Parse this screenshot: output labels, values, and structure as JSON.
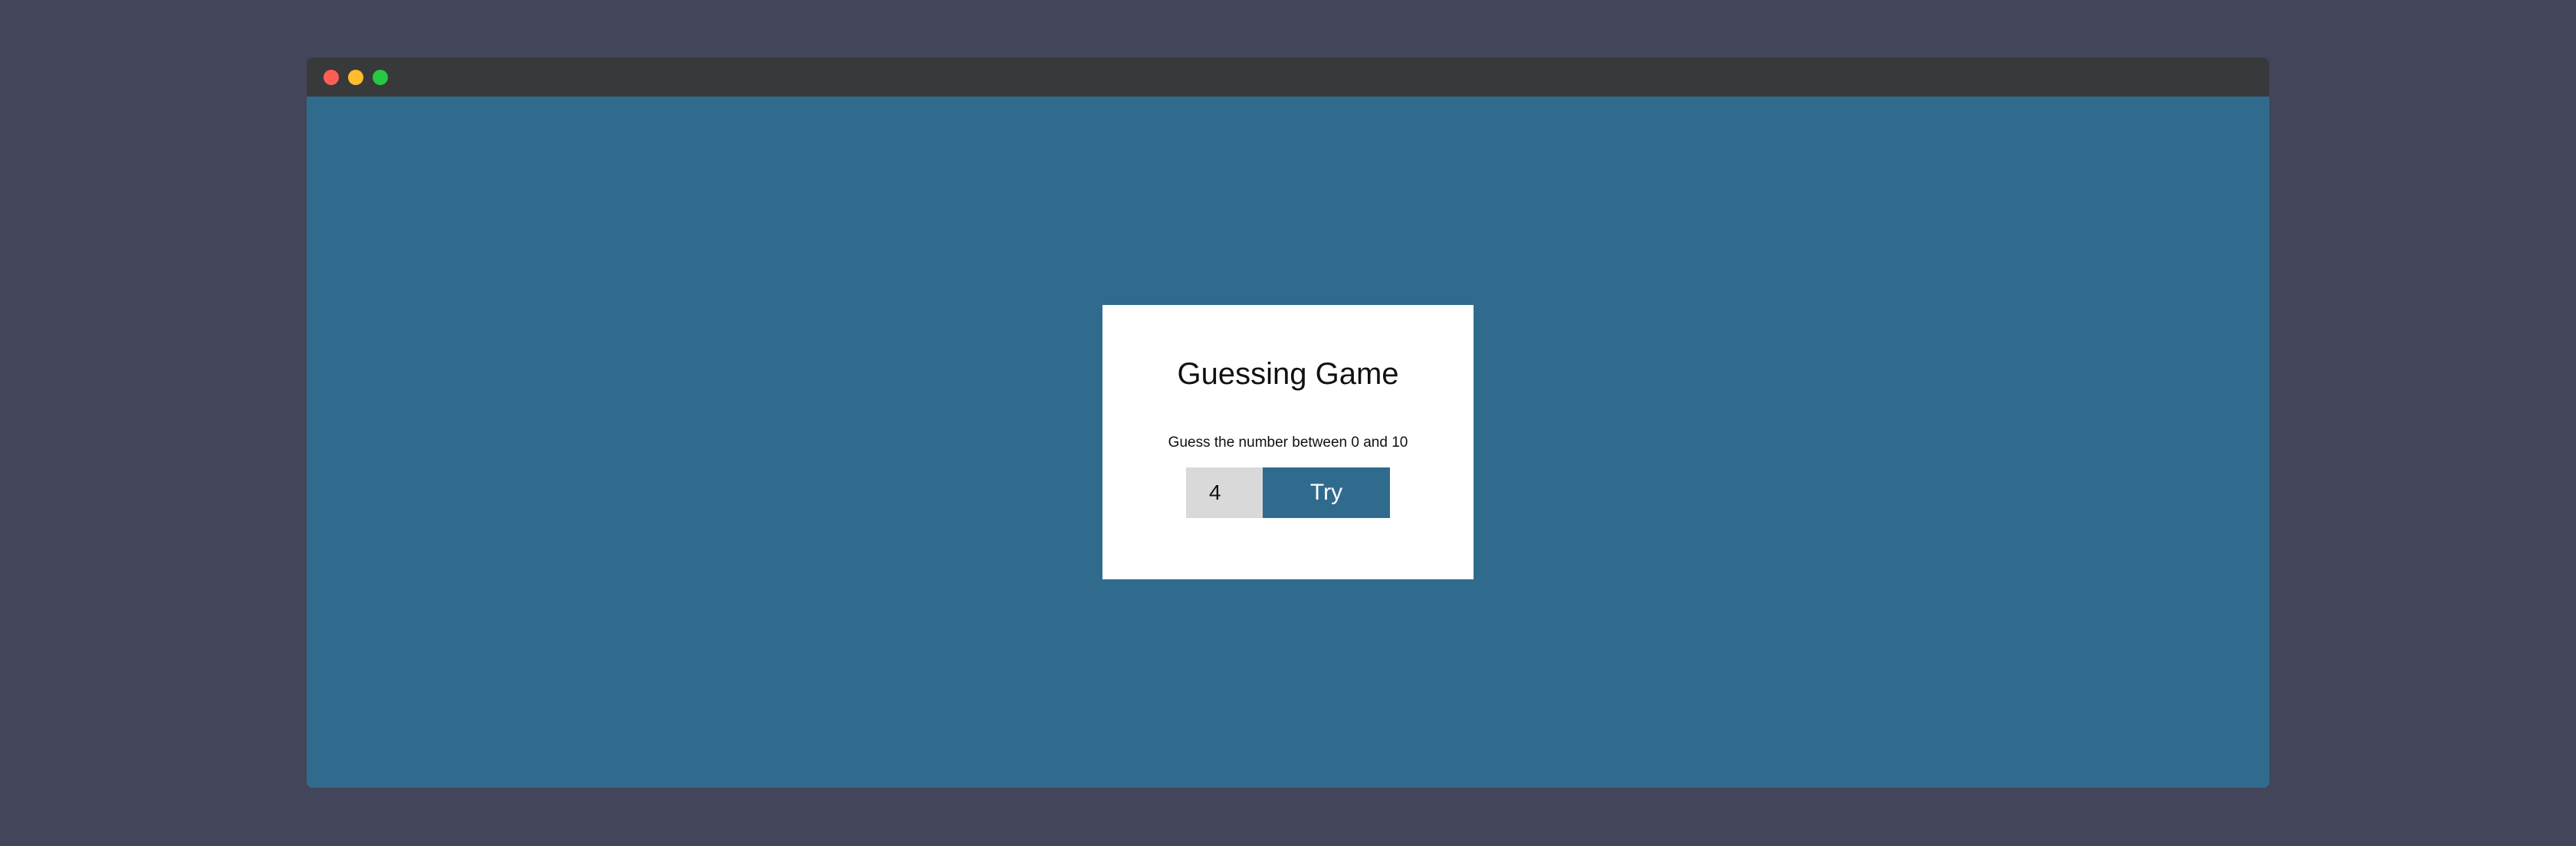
{
  "window": {
    "traffic_lights": {
      "close_color": "#fd5f57",
      "minimize_color": "#febc2e",
      "maximize_color": "#28c840"
    },
    "background_color": "#306b8e"
  },
  "game": {
    "title": "Guessing Game",
    "instructions": "Guess the number between 0 and 10",
    "guess_value": "4",
    "try_label": "Try"
  }
}
